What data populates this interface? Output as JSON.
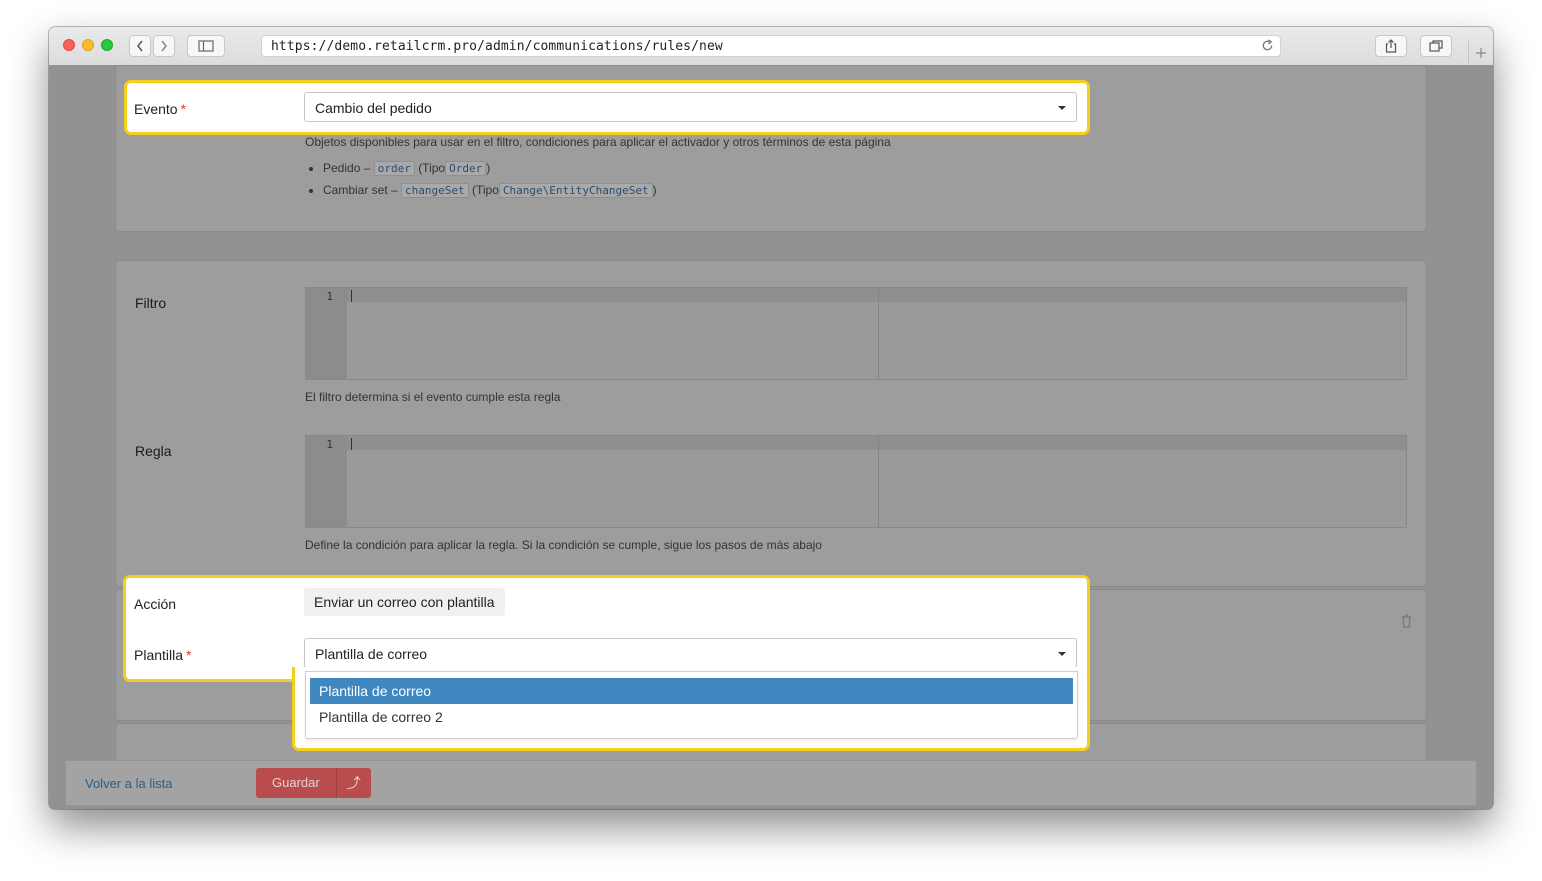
{
  "browser": {
    "url": "https://demo.retailcrm.pro/admin/communications/rules/new"
  },
  "event": {
    "label": "Evento",
    "required_mark": "*",
    "selected": "Cambio del pedido",
    "hint": "Objetos disponibles para usar en el filtro, condiciones para aplicar el activador y otros términos de esta página",
    "objects": [
      {
        "name": "Pedido –",
        "var": "order",
        "type_prefix": "(Tipo",
        "type": "Order",
        "type_suffix": ")"
      },
      {
        "name": "Cambiar set –",
        "var": "changeSet",
        "type_prefix": "(Tipo",
        "type": "Change\\EntityChangeSet",
        "type_suffix": ")"
      }
    ]
  },
  "filter": {
    "label": "Filtro",
    "line_number": "1",
    "hint": "El filtro determina si el evento cumple esta regla"
  },
  "rule": {
    "label": "Regla",
    "line_number": "1",
    "hint": "Define la condición para aplicar la regla. Si la condición se cumple, sigue los pasos de más abajo"
  },
  "action": {
    "label": "Acción",
    "value": "Enviar un correo con plantilla"
  },
  "template": {
    "label": "Plantilla",
    "required_mark": "*",
    "selected": "Plantilla de correo",
    "options": [
      "Plantilla de correo",
      "Plantilla de correo 2"
    ]
  },
  "footer": {
    "back_label": "Volver a la lista",
    "save_label": "Guardar",
    "save_up_glyph": "⤴"
  },
  "colors": {
    "highlight": "#f5cf1d",
    "selected_option": "#3f88bf",
    "save_button": "#b94d4d",
    "required": "#d9383a"
  }
}
